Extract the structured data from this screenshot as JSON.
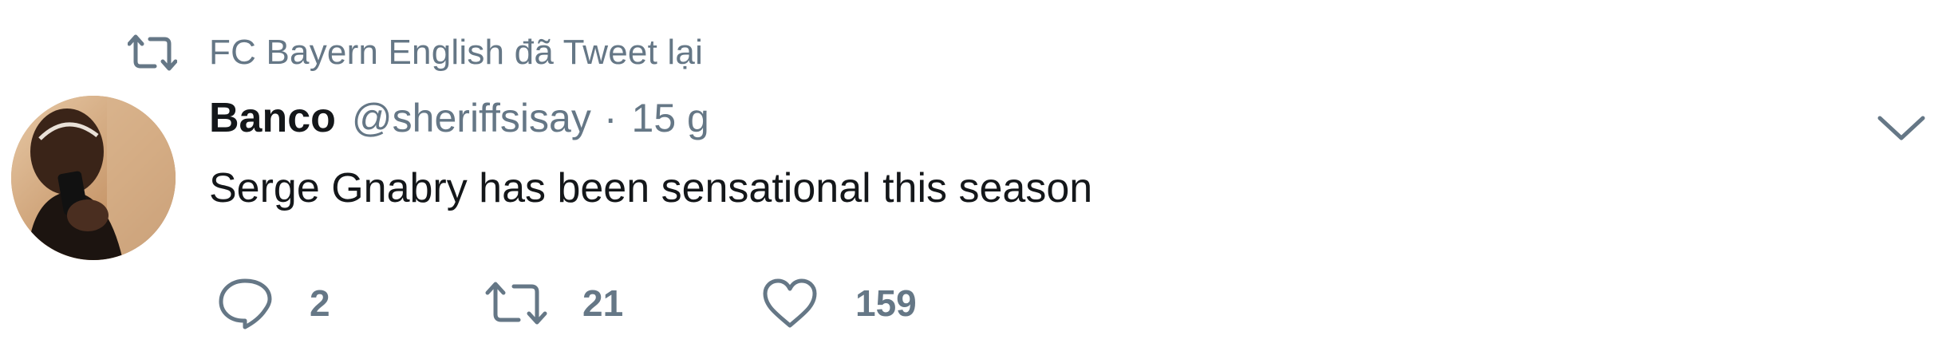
{
  "retweet_context": {
    "icon": "retweet-icon",
    "text": "FC Bayern English đã Tweet lại"
  },
  "tweet": {
    "avatar_icon": "user-avatar",
    "name": "Banco",
    "handle": "@sheriffsisay",
    "separator": "·",
    "time": "15 g",
    "text": "Serge Gnabry has been sensational this season",
    "menu_icon": "chevron-down-icon"
  },
  "actions": {
    "reply": {
      "icon": "reply-icon",
      "count": "2"
    },
    "retweet": {
      "icon": "retweet-icon",
      "count": "21"
    },
    "like": {
      "icon": "heart-icon",
      "count": "159"
    }
  },
  "colors": {
    "secondary_text": "#657786",
    "primary_text": "#14171a",
    "background": "#ffffff"
  }
}
